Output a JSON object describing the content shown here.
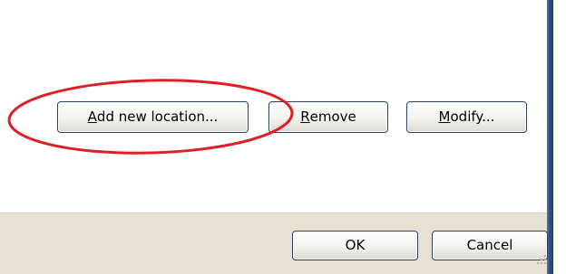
{
  "buttons": {
    "add_new_location": {
      "mnemonic": "A",
      "rest": "dd new location..."
    },
    "remove": {
      "mnemonic": "R",
      "rest": "emove"
    },
    "modify": {
      "mnemonic": "M",
      "rest": "odify..."
    },
    "ok": "OK",
    "cancel": "Cancel"
  },
  "annotation": {
    "color": "#e01e24",
    "shape": "ellipse"
  },
  "colors": {
    "window_frame": "#2f4e86",
    "footer": "#e6e1d2",
    "button_border": "#2f3f63"
  }
}
